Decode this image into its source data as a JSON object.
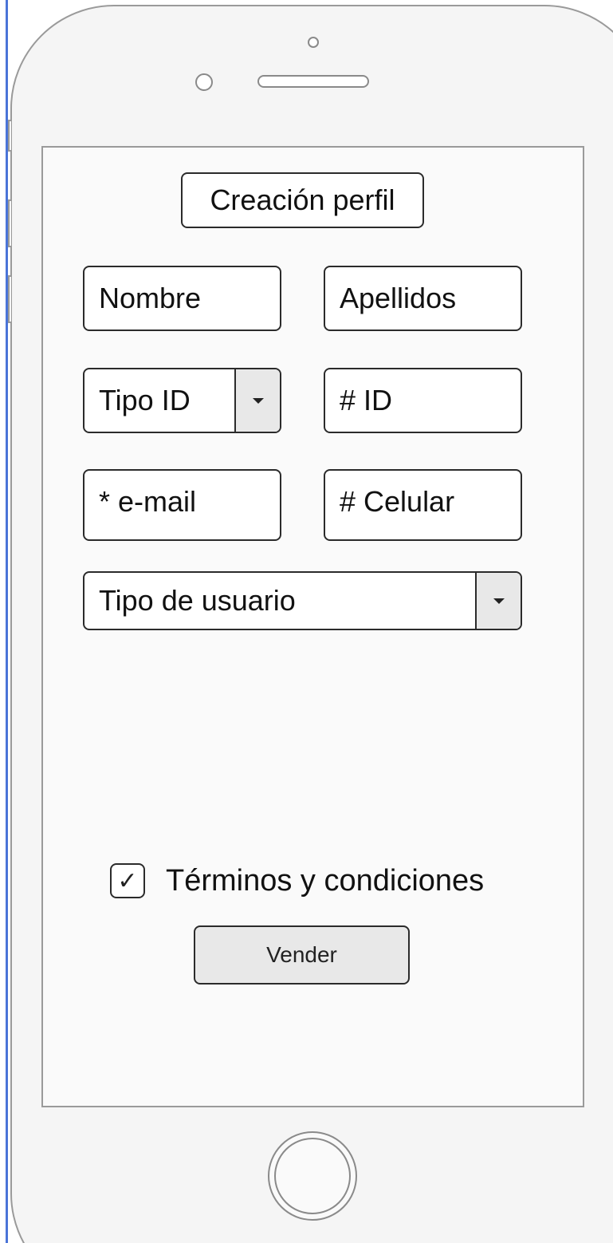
{
  "title": "Creación perfil",
  "fields": {
    "nombre": "Nombre",
    "apellidos": "Apellidos",
    "tipo_id": "Tipo ID",
    "numero_id": "# ID",
    "email": "* e-mail",
    "celular": "# Celular",
    "tipo_usuario": "Tipo de usuario"
  },
  "terms": {
    "label": "Términos y condiciones",
    "checked": true,
    "check_glyph": "✓"
  },
  "submit_label": "Vender",
  "colors": {
    "accent_edge": "#4a74d8",
    "button_fill": "#e8e8e8"
  }
}
